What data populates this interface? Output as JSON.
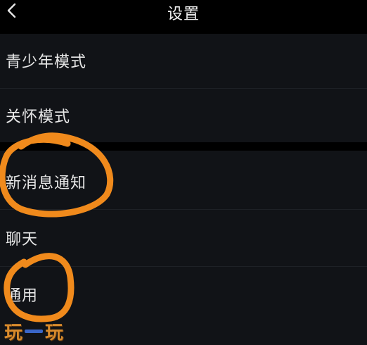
{
  "header": {
    "back_icon": "chevron-left-icon",
    "title": "设置"
  },
  "settings": {
    "group_1": [
      {
        "label": "青少年模式"
      },
      {
        "label": "关怀模式"
      }
    ],
    "group_2": [
      {
        "label": "新消息通知"
      },
      {
        "label": "聊天"
      },
      {
        "label": "通用"
      }
    ]
  },
  "annotations": {
    "highlight_color": "#f08a1c",
    "highlighted_items": [
      "新消息通知",
      "通用"
    ]
  },
  "watermark": {
    "text_left": "玩",
    "text_right": "玩",
    "colors": [
      "#d78a2c",
      "#3a66c8"
    ]
  },
  "colors": {
    "background": "#000000",
    "group_background": "#111317",
    "text": "#e8e8e8"
  }
}
